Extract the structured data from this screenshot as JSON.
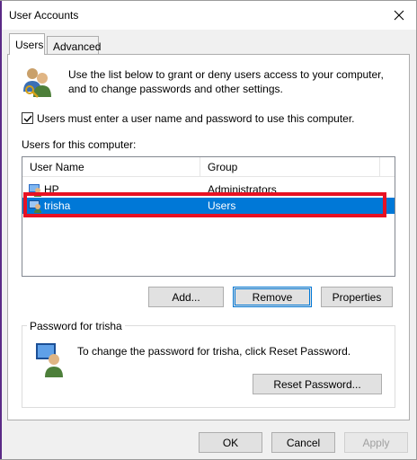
{
  "window": {
    "title": "User Accounts"
  },
  "tabs": [
    {
      "label": "Users",
      "active": true
    },
    {
      "label": "Advanced",
      "active": false
    }
  ],
  "intro": {
    "text": "Use the list below to grant or deny users access to your computer, and to change passwords and other settings."
  },
  "must_login": {
    "label": "Users must enter a user name and password to use this computer.",
    "checked": true
  },
  "users_list": {
    "label": "Users for this computer:",
    "columns": [
      "User Name",
      "Group"
    ],
    "rows": [
      {
        "name": "HP",
        "group": "Administrators",
        "selected": false
      },
      {
        "name": "trisha",
        "group": "Users",
        "selected": true
      }
    ]
  },
  "list_buttons": {
    "add": "Add...",
    "remove": "Remove",
    "properties": "Properties"
  },
  "password_group": {
    "title": "Password for trisha",
    "text": "To change the password for trisha, click Reset Password.",
    "reset_button": "Reset Password..."
  },
  "footer": {
    "ok": "OK",
    "cancel": "Cancel",
    "apply": "Apply"
  },
  "colors": {
    "selection": "#0078d7",
    "highlight": "#e81123",
    "accent_stripe": "#5b2a86"
  },
  "icons": {
    "users": "users-icon",
    "close": "close-icon",
    "user_row": "user-icon",
    "password": "password-user-icon"
  }
}
